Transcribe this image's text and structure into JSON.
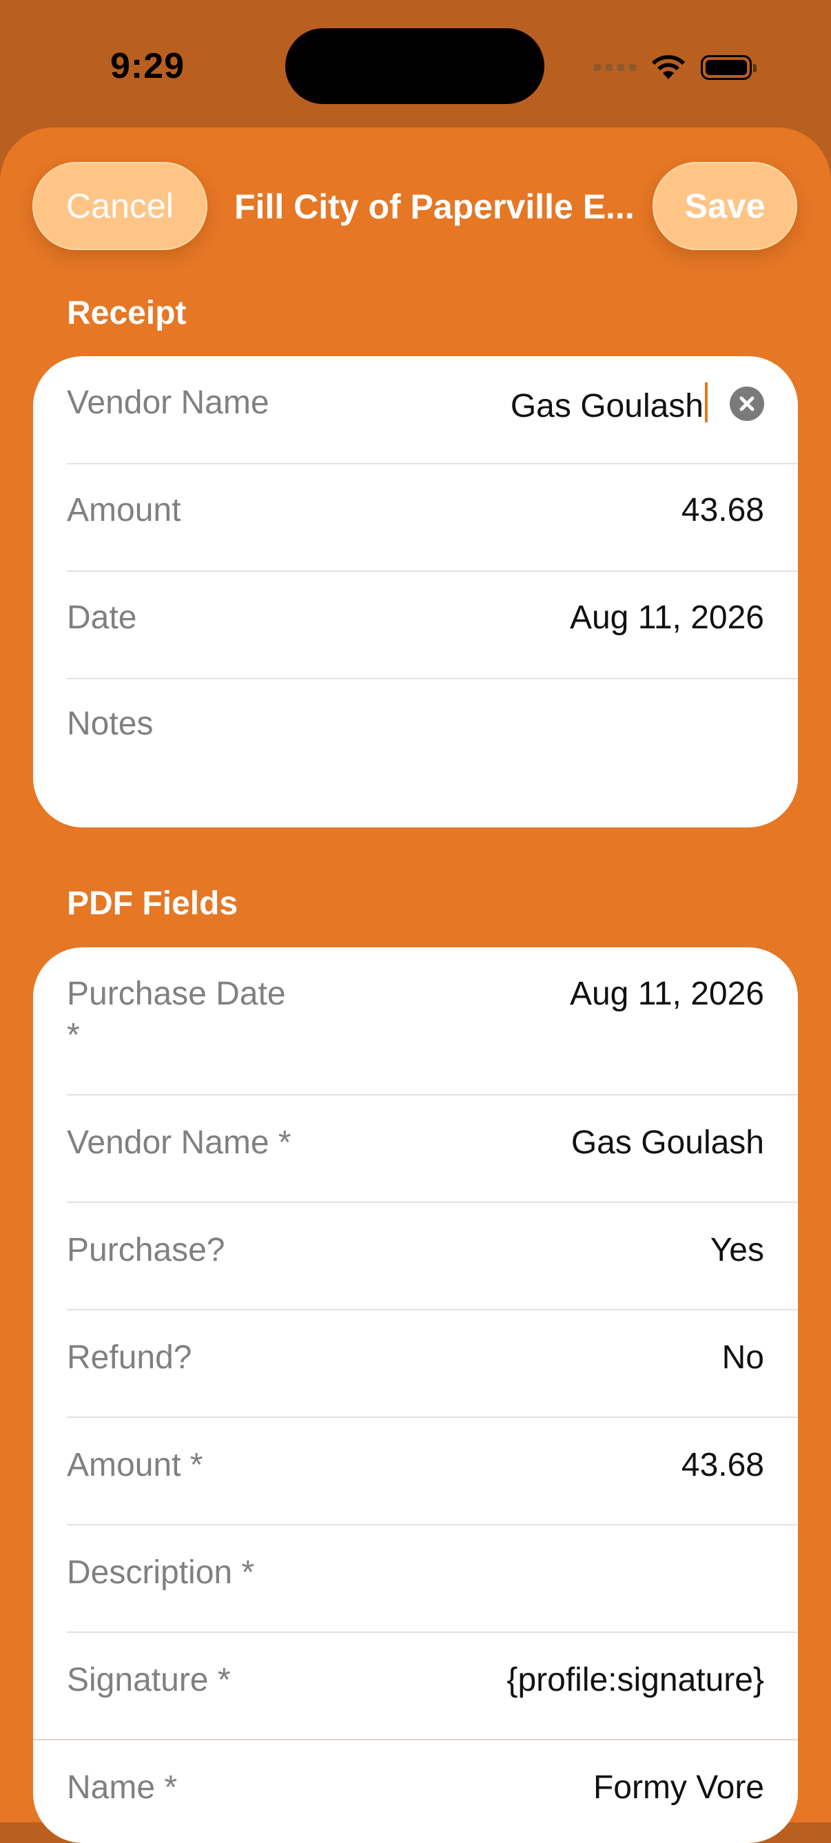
{
  "status": {
    "time": "9:29"
  },
  "nav": {
    "cancel": "Cancel",
    "title": "Fill City of Paperville E...",
    "save": "Save"
  },
  "receipt": {
    "header": "Receipt",
    "vendor_label": "Vendor Name",
    "vendor_value": "Gas Goulash",
    "amount_label": "Amount",
    "amount_value": "43.68",
    "date_label": "Date",
    "date_value": "Aug 11, 2026",
    "notes_placeholder": "Notes"
  },
  "pdf": {
    "header": "PDF Fields",
    "rows": [
      {
        "label_line1": "Purchase Date",
        "label_line2": "*",
        "value": "Aug 11, 2026"
      },
      {
        "label": "Vendor Name *",
        "value": "Gas Goulash"
      },
      {
        "label": "Purchase?",
        "value": "Yes"
      },
      {
        "label": "Refund?",
        "value": "No"
      },
      {
        "label": "Amount *",
        "value": "43.68"
      },
      {
        "label": "Description *",
        "value": ""
      },
      {
        "label": "Signature *",
        "value": "{profile:signature}"
      },
      {
        "label": "Name *",
        "value": "Formy Vore"
      }
    ]
  },
  "colors": {
    "accent": "#e57725",
    "button_fill": "#ffc587",
    "top_bar": "#b95f1f"
  },
  "icons": {
    "clear": "xmark-circle-icon",
    "wifi": "wifi-icon",
    "battery": "battery-icon",
    "signal": "cellular-signal-icon"
  }
}
